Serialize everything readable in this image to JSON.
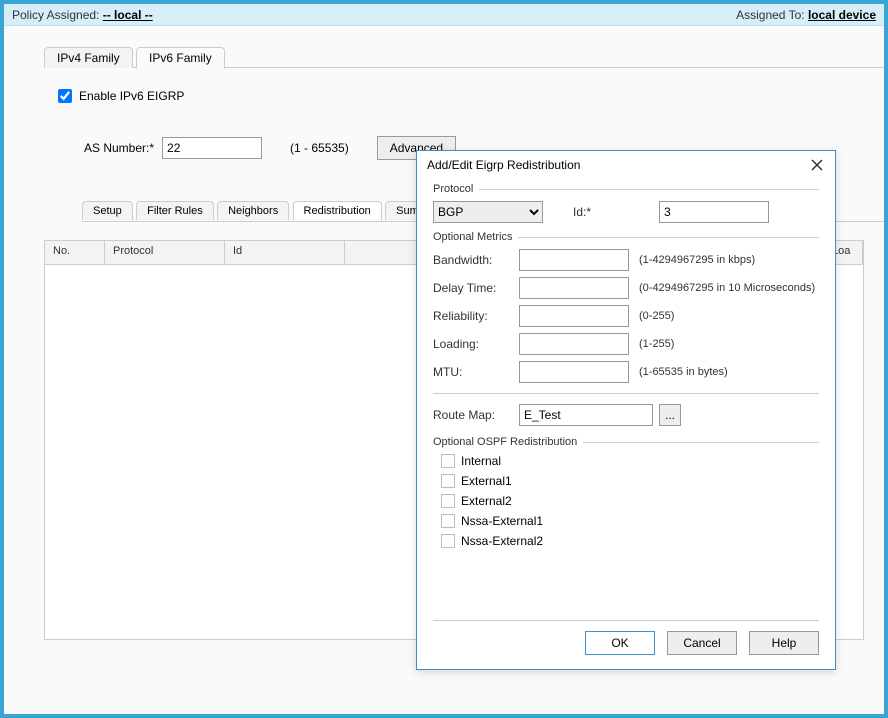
{
  "topbar": {
    "policy_assigned_label": "Policy Assigned:",
    "policy_assigned_value": "-- local --",
    "assigned_to_label": "Assigned To:",
    "assigned_to_value": "local device"
  },
  "main_tabs": [
    "IPv4 Family",
    "IPv6 Family"
  ],
  "main_tab_active": 1,
  "enable_checkbox_label": "Enable IPv6 EIGRP",
  "enable_checkbox_checked": true,
  "as_label": "AS Number:*",
  "as_value": "22",
  "as_range": "(1 - 65535)",
  "advanced_button": "Advanced",
  "sub_tabs": [
    "Setup",
    "Filter Rules",
    "Neighbors",
    "Redistribution",
    "Summary Address"
  ],
  "sub_tabs_visible": [
    "Setup",
    "Filter Rules",
    "Neighbors",
    "Redistribution",
    "Summary A"
  ],
  "sub_tab_active": 3,
  "table_columns": {
    "no": "No.",
    "protocol": "Protocol",
    "id": "Id",
    "loa": "Loa"
  },
  "modal": {
    "title": "Add/Edit Eigrp Redistribution",
    "protocol_group": "Protocol",
    "protocol_value": "BGP",
    "id_label": "Id:*",
    "id_value": "3",
    "metrics_group": "Optional Metrics",
    "bandwidth_label": "Bandwidth:",
    "bandwidth_hint": "(1-4294967295 in kbps)",
    "delay_label": "Delay Time:",
    "delay_hint": "(0-4294967295 in 10 Microseconds)",
    "reliability_label": "Reliability:",
    "reliability_hint": "(0-255)",
    "loading_label": "Loading:",
    "loading_hint": "(1-255)",
    "mtu_label": "MTU:",
    "mtu_hint": "(1-65535 in bytes)",
    "route_map_label": "Route Map:",
    "route_map_value": "E_Test",
    "route_map_picker": "...",
    "ospf_group": "Optional OSPF Redistribution",
    "ospf_options": [
      "Internal",
      "External1",
      "External2",
      "Nssa-External1",
      "Nssa-External2"
    ],
    "buttons": {
      "ok": "OK",
      "cancel": "Cancel",
      "help": "Help"
    }
  }
}
